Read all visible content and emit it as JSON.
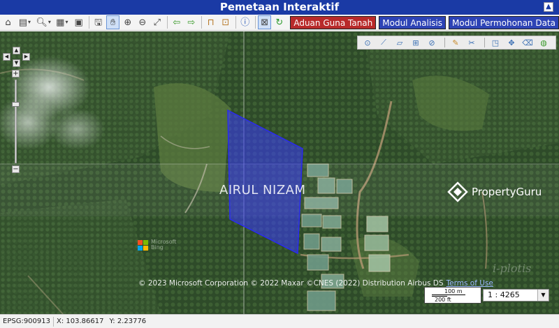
{
  "title": "Pemetaan Interaktif",
  "collapse_icon": "chevron-up-icon",
  "toolbar": {
    "modules": [
      {
        "label": "Aduan Guna Tanah",
        "color": "#b82a2a"
      },
      {
        "label": "Modul Analisis",
        "color": "#2d43b5"
      },
      {
        "label": "Modul Permohonan Data",
        "color": "#2d43b5"
      }
    ]
  },
  "map": {
    "watermark_name": "AIRUL NIZAM",
    "watermark_brand": "PropertyGuru",
    "bing_logo_text": [
      "Microsoft",
      "Bing"
    ],
    "iplot_text": "i-plotis",
    "attribution": "© 2023 Microsoft Corporation © 2022 Maxar ©CNES (2022) Distribution Airbus DS",
    "terms_link": "Terms of Use",
    "parcel_color": "#3a3aff",
    "scale": {
      "metric": "100 m",
      "imperial": "200 ft"
    },
    "ratio": "1 : 4265"
  },
  "status": {
    "epsg": "EPSG:900913",
    "x": "X: 103.86617",
    "y": "Y: 2.23776"
  }
}
